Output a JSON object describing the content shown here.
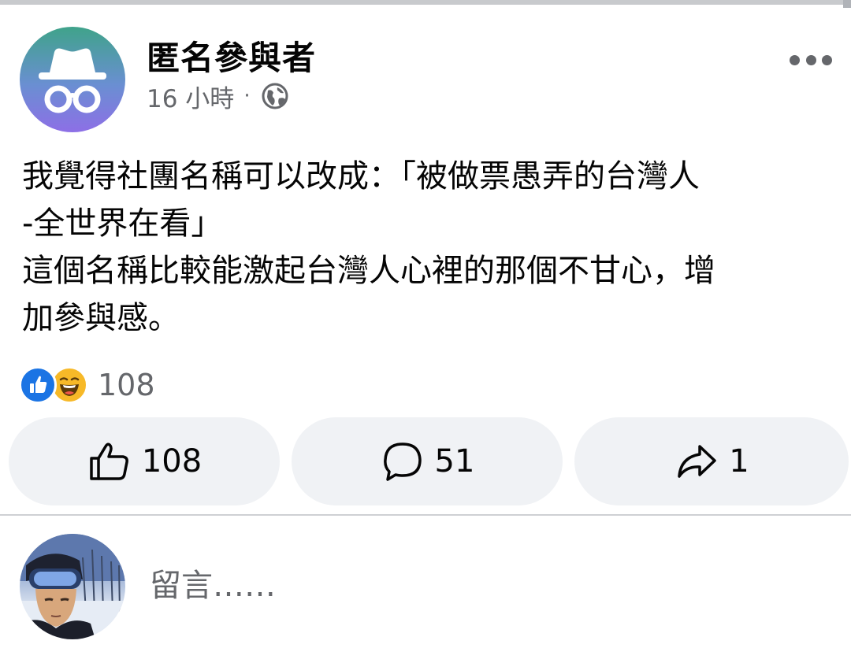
{
  "post": {
    "author": "匿名參與者",
    "time": "16 小時",
    "separator": "·",
    "privacy_icon": "globe-icon",
    "text": "我覺得社團名稱可以改成：「被做票愚弄的台灣人\n-全世界在看」\n這個名稱比較能激起台灣人心裡的那個不甘心，增\n加參與感。"
  },
  "reactions": {
    "icons": [
      "like-icon",
      "haha-icon"
    ],
    "count": "108"
  },
  "actions": {
    "like_count": "108",
    "comment_count": "51",
    "share_count": "1"
  },
  "comment_box": {
    "placeholder": "留言……"
  },
  "colors": {
    "like_blue": "#1b74e4",
    "haha_yellow": "#f7b928",
    "button_bg": "#f0f2f5",
    "secondary_text": "#65676b"
  }
}
